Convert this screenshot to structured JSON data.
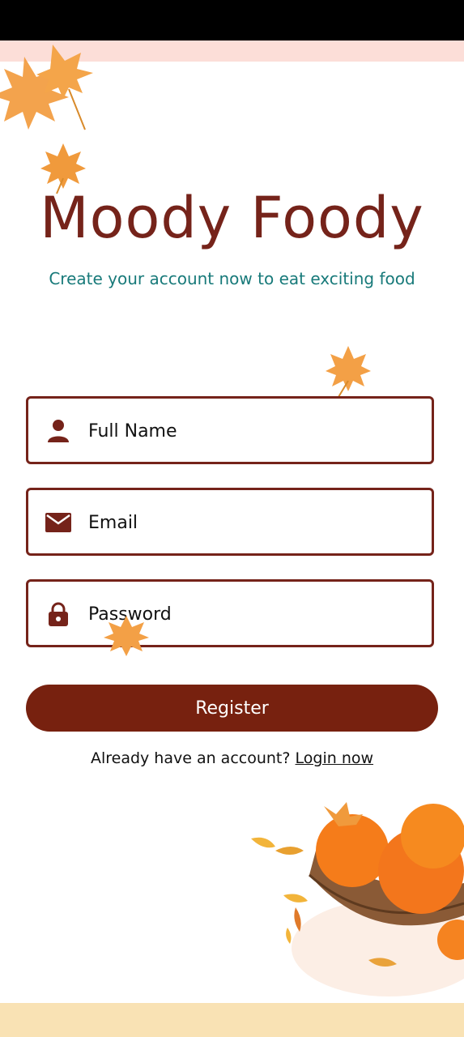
{
  "app": {
    "title": "Moody Foody",
    "subtitle": "Create your account now to eat exciting food"
  },
  "form": {
    "full_name": {
      "placeholder": "Full Name",
      "value": "",
      "icon": "person-icon"
    },
    "email": {
      "placeholder": "Email",
      "value": "",
      "icon": "mail-icon"
    },
    "password": {
      "placeholder": "Password",
      "value": "",
      "icon": "lock-icon"
    }
  },
  "actions": {
    "register_label": "Register",
    "login_prompt": "Already have an account?",
    "login_link": "Login now"
  },
  "theme": {
    "primary": "#75231a",
    "accent": "#187a7a",
    "top_band": "#fcded8",
    "bottom_band": "#f9e2b4"
  },
  "decor": {
    "leaf_icon": "maple-leaf-icon",
    "fruit_bowl": "orange-fruit-bowl-illustration"
  }
}
